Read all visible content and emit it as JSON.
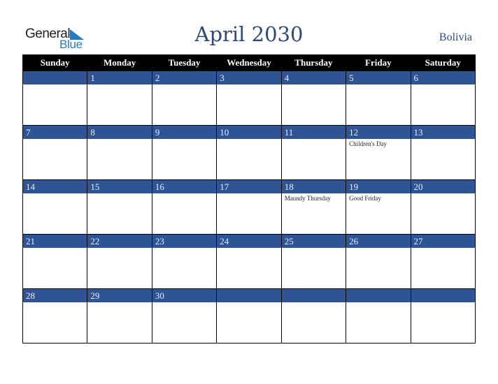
{
  "logo": {
    "word1": "General",
    "word2": "Blue"
  },
  "header": {
    "title": "April 2030",
    "country": "Bolivia"
  },
  "colors": {
    "accent": "#2e5496",
    "header_bg": "#000000",
    "title": "#2e4a7a"
  },
  "weekdays": [
    "Sunday",
    "Monday",
    "Tuesday",
    "Wednesday",
    "Thursday",
    "Friday",
    "Saturday"
  ],
  "weeks": [
    [
      {
        "day": "",
        "event": ""
      },
      {
        "day": "1",
        "event": ""
      },
      {
        "day": "2",
        "event": ""
      },
      {
        "day": "3",
        "event": ""
      },
      {
        "day": "4",
        "event": ""
      },
      {
        "day": "5",
        "event": ""
      },
      {
        "day": "6",
        "event": ""
      }
    ],
    [
      {
        "day": "7",
        "event": ""
      },
      {
        "day": "8",
        "event": ""
      },
      {
        "day": "9",
        "event": ""
      },
      {
        "day": "10",
        "event": ""
      },
      {
        "day": "11",
        "event": ""
      },
      {
        "day": "12",
        "event": "Children's Day"
      },
      {
        "day": "13",
        "event": ""
      }
    ],
    [
      {
        "day": "14",
        "event": ""
      },
      {
        "day": "15",
        "event": ""
      },
      {
        "day": "16",
        "event": ""
      },
      {
        "day": "17",
        "event": ""
      },
      {
        "day": "18",
        "event": "Maundy Thursday"
      },
      {
        "day": "19",
        "event": "Good Friday"
      },
      {
        "day": "20",
        "event": ""
      }
    ],
    [
      {
        "day": "21",
        "event": ""
      },
      {
        "day": "22",
        "event": ""
      },
      {
        "day": "23",
        "event": ""
      },
      {
        "day": "24",
        "event": ""
      },
      {
        "day": "25",
        "event": ""
      },
      {
        "day": "26",
        "event": ""
      },
      {
        "day": "27",
        "event": ""
      }
    ],
    [
      {
        "day": "28",
        "event": ""
      },
      {
        "day": "29",
        "event": ""
      },
      {
        "day": "30",
        "event": ""
      },
      {
        "day": "",
        "event": ""
      },
      {
        "day": "",
        "event": ""
      },
      {
        "day": "",
        "event": ""
      },
      {
        "day": "",
        "event": ""
      }
    ]
  ]
}
